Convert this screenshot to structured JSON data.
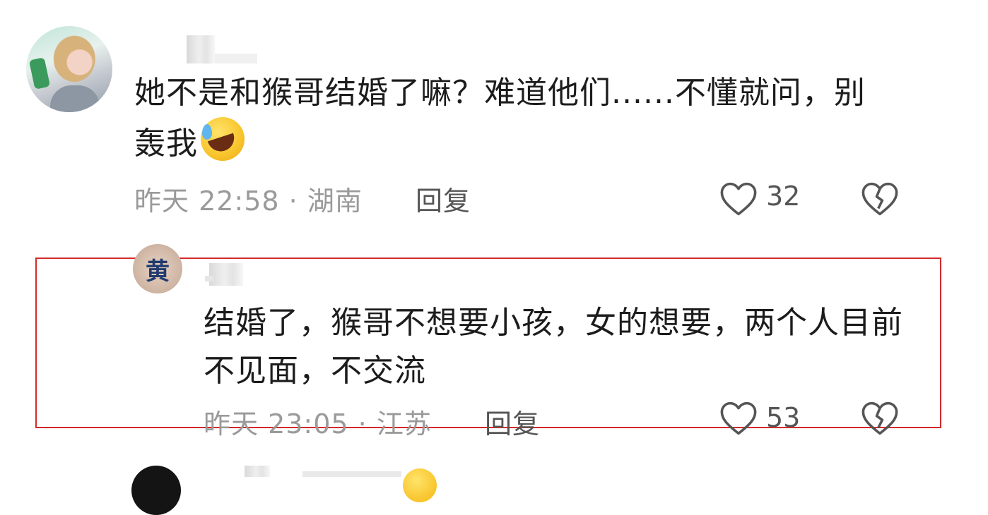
{
  "comments": [
    {
      "text": "她不是和猴哥结婚了嘛？难道他们......不懂就问，别轰我",
      "emoji": "laughing-crying-emoji",
      "meta": "昨天 22:58 · 湖南",
      "reply_label": "回复",
      "like_count": "32"
    },
    {
      "avatar_char": "黄",
      "text": "结婚了，猴哥不想要小孩，女的想要，两个人目前不见面，不交流",
      "meta": "昨天 23:05 · 江苏",
      "reply_label": "回复",
      "like_count": "53"
    }
  ],
  "colors": {
    "highlight_border": "#d42a2a",
    "meta_text": "#9a9a9a",
    "icon_stroke": "#555555"
  }
}
